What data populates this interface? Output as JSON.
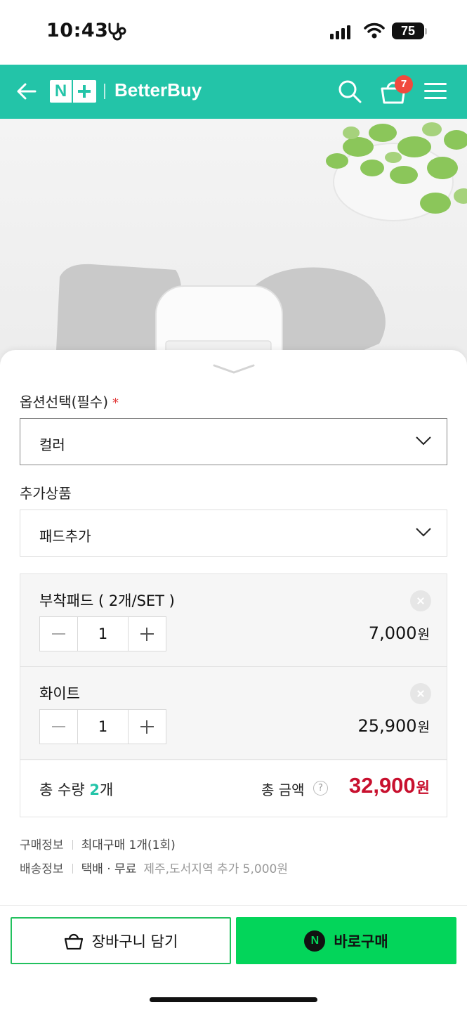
{
  "status_bar": {
    "time": "10:43",
    "battery": "75"
  },
  "header": {
    "logo_text": "N",
    "brand": "BetterBuy",
    "cart_count": "7",
    "accent_color": "#23c4a8"
  },
  "options": {
    "required_label": "옵션선택(필수)",
    "required_mark": "*",
    "color_select": "컬러",
    "addon_label": "추가상품",
    "addon_select": "패드추가"
  },
  "items": [
    {
      "name": "부착패드 ( 2개/SET )",
      "qty": "1",
      "price": "7,000",
      "currency": "원"
    },
    {
      "name": "화이트",
      "qty": "1",
      "price": "25,900",
      "currency": "원"
    }
  ],
  "total": {
    "qty_prefix": "총 수량 ",
    "qty_value": "2",
    "qty_suffix": "개",
    "amount_label": "총 금액",
    "help": "?",
    "amount": "32,900",
    "currency": "원",
    "amount_color": "#c8102e"
  },
  "info": {
    "purchase_label": "구매정보",
    "purchase_value": "최대구매 1개(1회)",
    "shipping_label": "배송정보",
    "shipping_value": "택배 · 무료",
    "shipping_extra": "제주,도서지역 추가 5,000원"
  },
  "actions": {
    "cart_button": "장바구니 담기",
    "buy_icon": "N",
    "buy_button": "바로구매",
    "buy_color": "#03d55a"
  }
}
